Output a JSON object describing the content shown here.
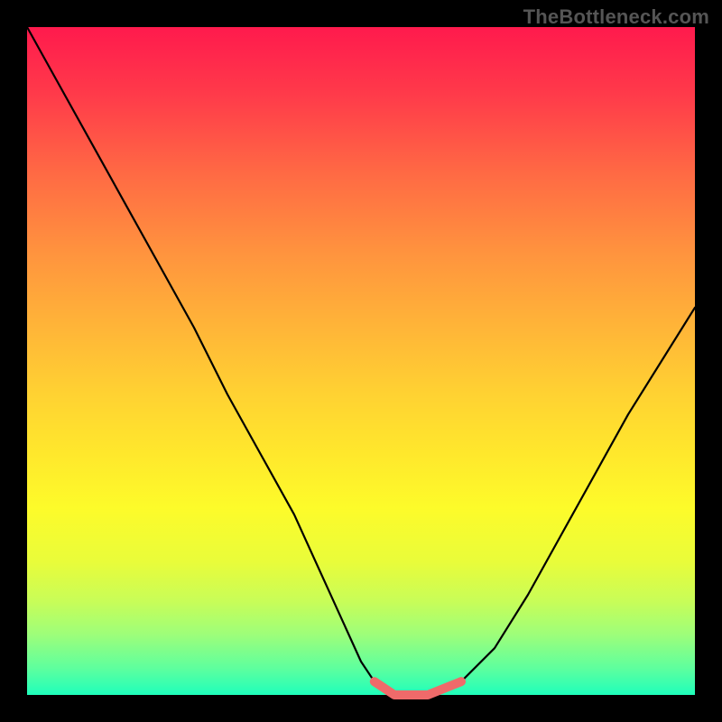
{
  "watermark": "TheBottleneck.com",
  "colors": {
    "page_bg": "#000000",
    "curve_stroke": "#000000",
    "bottom_accent": "#ef6a6a",
    "gradient_top": "#ff1a4d",
    "gradient_bottom": "#1fffbb"
  },
  "chart_data": {
    "type": "line",
    "title": "",
    "xlabel": "",
    "ylabel": "",
    "x": [
      0.0,
      0.05,
      0.1,
      0.15,
      0.2,
      0.25,
      0.3,
      0.35,
      0.4,
      0.45,
      0.5,
      0.52,
      0.55,
      0.58,
      0.6,
      0.65,
      0.7,
      0.75,
      0.8,
      0.85,
      0.9,
      0.95,
      1.0
    ],
    "series": [
      {
        "name": "curve",
        "values": [
          1.0,
          0.91,
          0.82,
          0.73,
          0.64,
          0.55,
          0.45,
          0.36,
          0.27,
          0.16,
          0.05,
          0.02,
          0.0,
          0.0,
          0.0,
          0.02,
          0.07,
          0.15,
          0.24,
          0.33,
          0.42,
          0.5,
          0.58
        ]
      }
    ],
    "xlim": [
      0,
      1
    ],
    "ylim": [
      0,
      1
    ],
    "grid": false,
    "legend": false,
    "notes": "Normalized coordinates; x is horizontal fraction of plot width, y is fraction of plot height from bottom. V-shaped curve with a small flat segment near the minimum, highlighted with a salmon accent."
  }
}
